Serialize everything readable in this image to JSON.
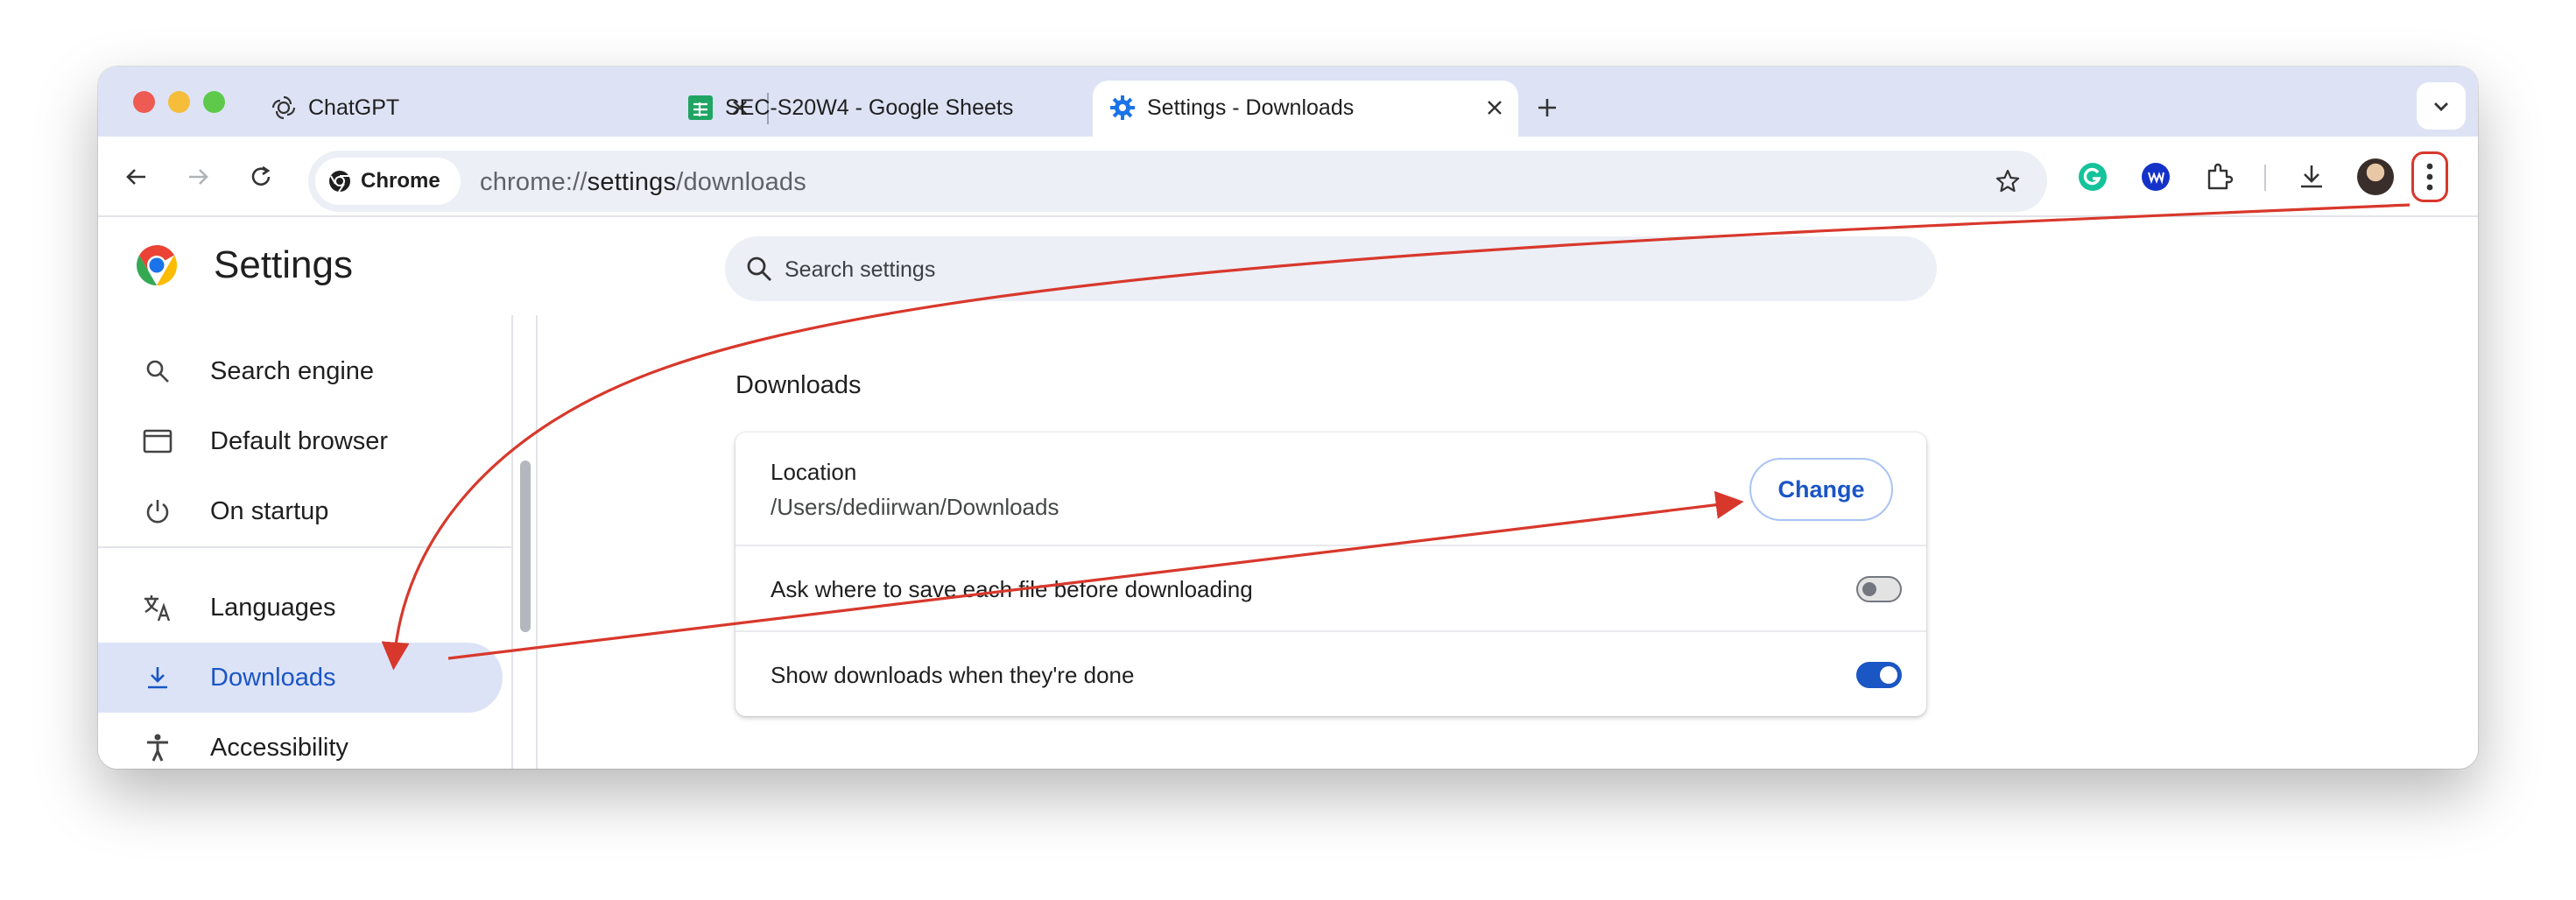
{
  "browser": {
    "tabs": [
      {
        "title": "ChatGPT",
        "icon": "chatgpt-icon",
        "active": false
      },
      {
        "title": "SEC-S20W4 - Google Sheets",
        "icon": "google-sheets-icon",
        "active": false
      },
      {
        "title": "Settings - Downloads",
        "icon": "settings-gear-icon",
        "active": true
      }
    ],
    "omnibox": {
      "chip_label": "Chrome",
      "url_prefix": "chrome://",
      "url_host": "settings",
      "url_path": "/downloads"
    }
  },
  "settings": {
    "title": "Settings",
    "search_placeholder": "Search settings",
    "nav": [
      {
        "label": "Search engine",
        "icon": "search-icon",
        "selected": false
      },
      {
        "label": "Default browser",
        "icon": "browser-window-icon",
        "selected": false
      },
      {
        "label": "On startup",
        "icon": "power-icon",
        "selected": false
      },
      {
        "label": "Languages",
        "icon": "translate-icon",
        "selected": false
      },
      {
        "label": "Downloads",
        "icon": "download-icon",
        "selected": true
      },
      {
        "label": "Accessibility",
        "icon": "accessibility-icon",
        "selected": false
      }
    ],
    "section_title": "Downloads",
    "location_label": "Location",
    "location_path": "/Users/dediirwan/Downloads",
    "change_label": "Change",
    "ask_label": "Ask where to save each file before downloading",
    "ask_enabled": false,
    "show_label": "Show downloads when they're done",
    "show_enabled": true
  },
  "colors": {
    "accent": "#1a56c4",
    "annotation": "#d8382c",
    "tabstrip": "#dde3f5"
  }
}
